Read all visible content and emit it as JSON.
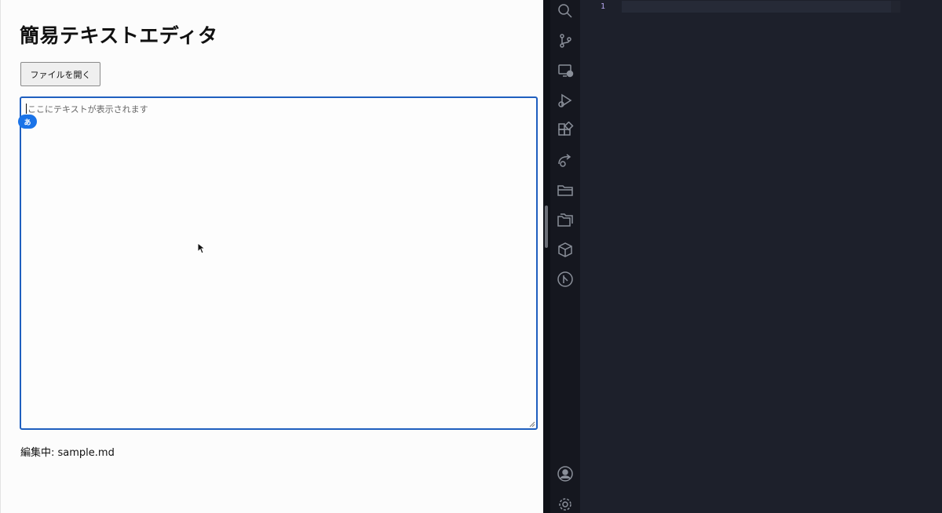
{
  "app": {
    "title": "簡易テキストエディタ",
    "open_button_label": "ファイルを開く",
    "editor_placeholder": "ここにテキストが表示されます",
    "ime_indicator": "あ",
    "status_text": "編集中: sample.md"
  },
  "code_editor": {
    "line_numbers": [
      "1"
    ]
  },
  "activity_bar": {
    "icons": [
      "search-icon",
      "source-control-icon",
      "remote-explorer-icon",
      "run-debug-icon",
      "extensions-icon",
      "live-share-icon",
      "folder-icon",
      "folders-icon",
      "package-icon",
      "git-graph-icon",
      "account-icon",
      "settings-gear-icon"
    ]
  },
  "colors": {
    "editor_border": "#1f5fbf",
    "ime_badge": "#1a73e8",
    "ide_background": "#1d202b",
    "line_number": "#b7a7f0"
  }
}
